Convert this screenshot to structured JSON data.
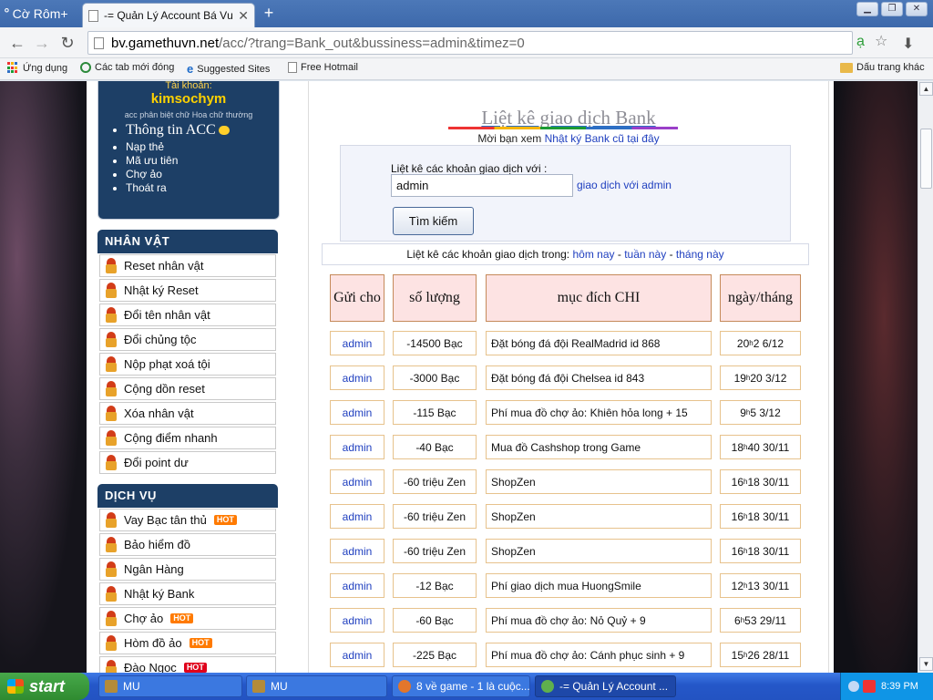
{
  "browser": {
    "logo": "Cờ Rôm+",
    "tab_title": "-= Quản Lý Account Bá Vươn",
    "url_host": "bv.gamethuvn.net",
    "url_path": "/acc/?trang=Bank_out&bussiness=admin&timez=0",
    "bookmarks": {
      "apps": "Ứng dụng",
      "recent_tabs": "Các tab mới đóng",
      "suggested": "Suggested Sites",
      "hotmail": "Free Hotmail",
      "other": "Dấu trang khác"
    }
  },
  "account": {
    "label": "Tài khoản:",
    "name": "kimsochym",
    "note": "acc phân biệt chữ Hoa chữ thường",
    "menu": [
      "Thông tin ACC",
      "Nạp thẻ",
      "Mã ưu tiên",
      "Chợ ảo",
      "Thoát ra"
    ]
  },
  "nhan_vat": {
    "title": "NHÂN VẬT",
    "items": [
      "Reset nhân vật",
      "Nhật ký Reset",
      "Đổi tên nhân vật",
      "Đổi chủng tộc",
      "Nộp phạt xoá tội",
      "Cộng dồn reset",
      "Xóa nhân vật",
      "Cộng điểm nhanh",
      "Đổi point dư"
    ]
  },
  "dich_vu": {
    "title": "DỊCH VỤ",
    "items": [
      "Vay Bạc tân thủ",
      "Bảo hiểm đồ",
      "Ngân Hàng",
      "Nhật ký Bank",
      "Chợ ảo",
      "Hòm đồ ảo",
      "Đào Ngọc"
    ],
    "hot": "HOT"
  },
  "main": {
    "title": "Liệt kê giao dịch Bank",
    "sub_prefix": "Mời bạn xem ",
    "sub_link": "Nhật ký Bank cũ tại đây",
    "search_label": "Liệt kê các khoản giao dịch với :",
    "search_value": "admin",
    "search_link": "giao dịch với admin",
    "search_button": "Tìm kiếm",
    "range_prefix": "Liệt kê các khoản giao dịch trong: ",
    "range_today": "hôm nay",
    "range_week": "tuần này",
    "range_month": "tháng này",
    "sep": " - "
  },
  "table": {
    "headers": [
      "Gửi cho",
      "số lượng",
      "mục đích CHI",
      "ngày/tháng"
    ],
    "rows": [
      {
        "to": "admin",
        "amount": "-14500  Bạc",
        "purpose": "Đặt bóng đá đội RealMadrid id 868",
        "h": "20",
        "time": "2 6/12"
      },
      {
        "to": "admin",
        "amount": "-3000  Bạc",
        "purpose": "Đặt bóng đá đội Chelsea id 843",
        "h": "19",
        "time": "20 3/12"
      },
      {
        "to": "admin",
        "amount": "-115  Bạc",
        "purpose": "Phí mua đồ chợ ảo: Khiên hỏa long + 15",
        "h": "9",
        "time": "5 3/12"
      },
      {
        "to": "admin",
        "amount": "-40  Bạc",
        "purpose": "Mua đồ Cashshop trong Game",
        "h": "18",
        "time": "40 30/11"
      },
      {
        "to": "admin",
        "amount": "-60  triệu Zen",
        "purpose": "ShopZen",
        "h": "16",
        "time": "18 30/11"
      },
      {
        "to": "admin",
        "amount": "-60  triệu Zen",
        "purpose": "ShopZen",
        "h": "16",
        "time": "18 30/11"
      },
      {
        "to": "admin",
        "amount": "-60  triệu Zen",
        "purpose": "ShopZen",
        "h": "16",
        "time": "18 30/11"
      },
      {
        "to": "admin",
        "amount": "-12  Bạc",
        "purpose": "Phí giao dịch mua HuongSmile",
        "h": "12",
        "time": "13 30/11"
      },
      {
        "to": "admin",
        "amount": "-60  Bạc",
        "purpose": "Phí mua đồ chợ ảo: Nỏ Quỷ + 9",
        "h": "6",
        "time": "53 29/11"
      },
      {
        "to": "admin",
        "amount": "-225  Bạc",
        "purpose": "Phí mua đồ chợ ảo: Cánh phục sinh + 9",
        "h": "15",
        "time": "26 28/11"
      }
    ],
    "hour_mark": "h"
  },
  "taskbar": {
    "start": "start",
    "tasks": [
      "MU",
      "MU",
      "8 về game - 1 là cuộc...",
      "-= Quản Lý Account ..."
    ],
    "clock": "8:39 PM"
  }
}
